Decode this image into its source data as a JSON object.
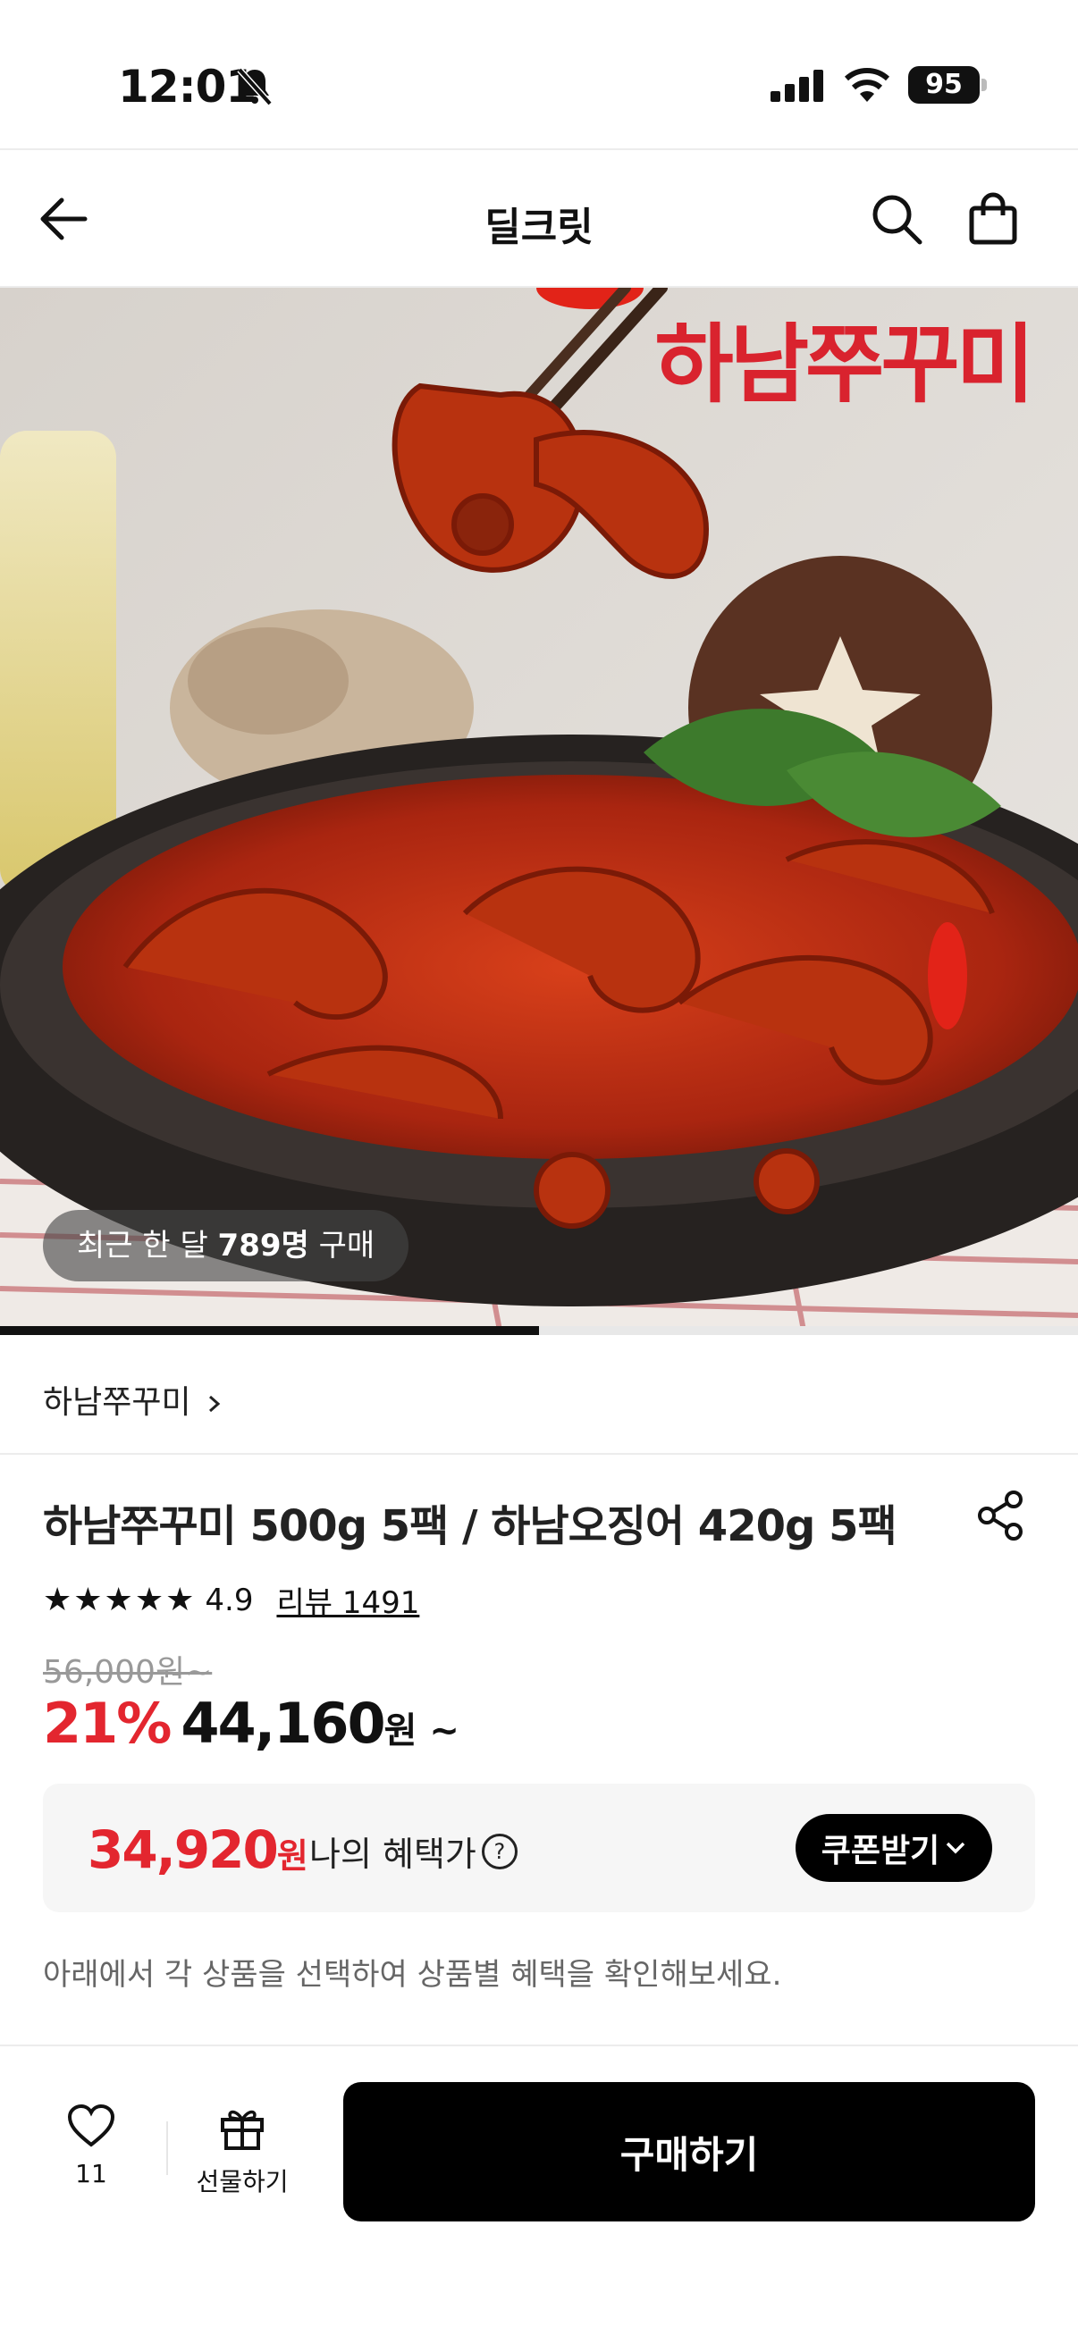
{
  "status_bar": {
    "time": "12:01",
    "battery": "95"
  },
  "nav": {
    "title": "딜크릿"
  },
  "hero": {
    "brand_logo_text": "하남쭈꾸미",
    "purchase_prefix": "최근 한 달 ",
    "purchase_count": "789명",
    "purchase_suffix": " 구매",
    "image_progress": 0.5
  },
  "product": {
    "brand": "하남쭈꾸미",
    "title": "하남쭈꾸미 500g 5팩 / 하남오징어 420g 5팩",
    "stars": "★★★★★",
    "rating": "4.9",
    "review_link": "리뷰 1491",
    "original_price": "56,000원~",
    "discount": "21%",
    "price": "44,160",
    "price_unit": "원 ~"
  },
  "benefit": {
    "price": "34,920",
    "unit": "원",
    "label": "나의 혜택가",
    "coupon_button": "쿠폰받기"
  },
  "notice": "아래에서 각 상품을 선택하여 상품별 혜택을 확인해보세요.",
  "bottom_bar": {
    "like_count": "11",
    "gift_label": "선물하기",
    "buy_label": "구매하기"
  },
  "colors": {
    "accent_red": "#e3262f",
    "brand_red": "#d9232e"
  }
}
